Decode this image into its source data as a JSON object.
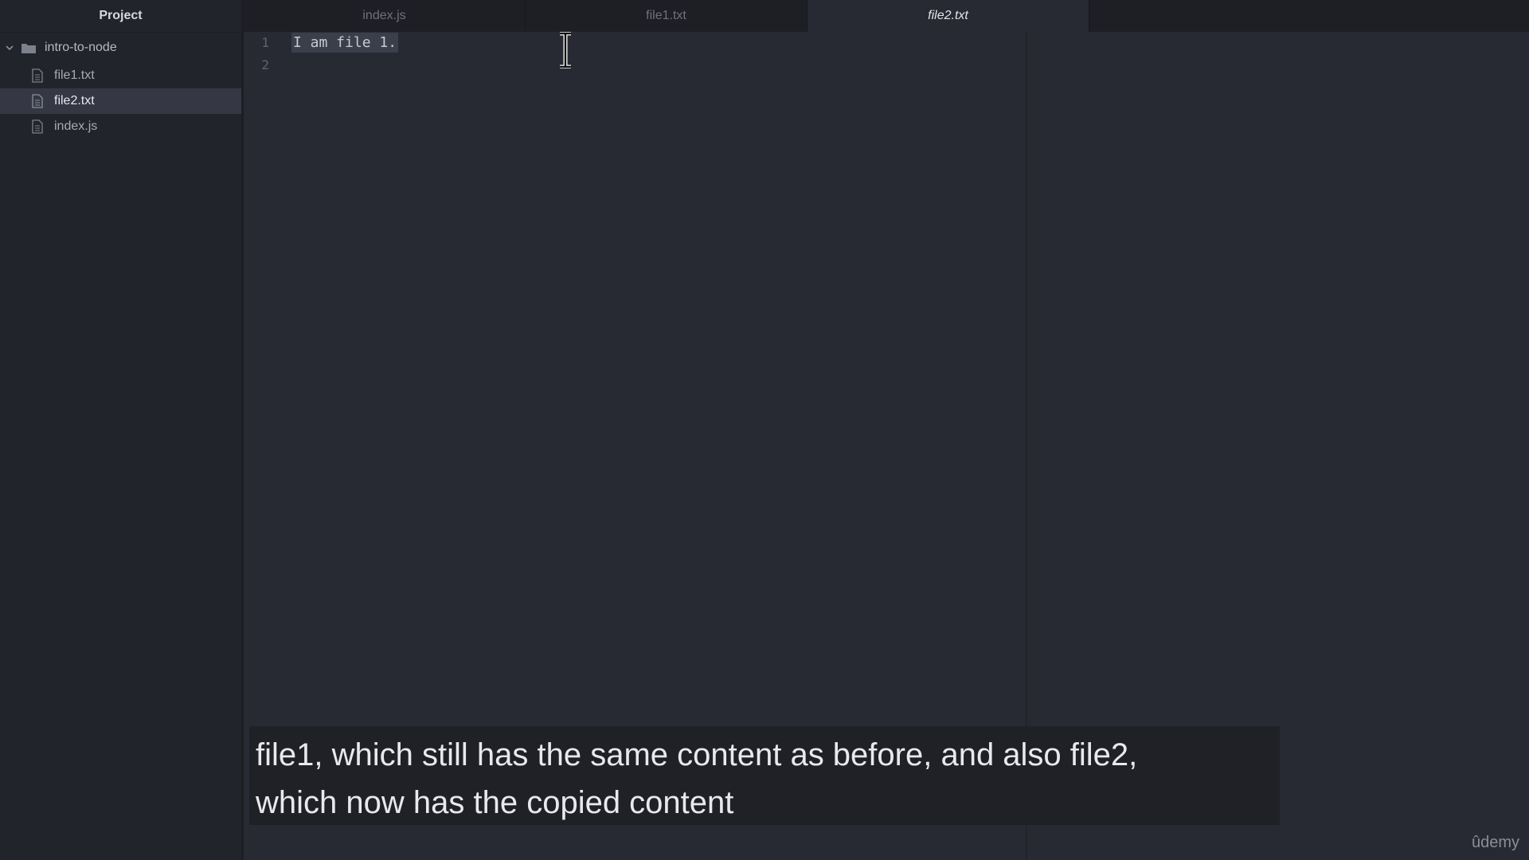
{
  "sidebar": {
    "title": "Project",
    "root_folder": "intro-to-node",
    "files": [
      {
        "name": "file1.txt",
        "selected": false
      },
      {
        "name": "file2.txt",
        "selected": true
      },
      {
        "name": "index.js",
        "selected": false
      }
    ]
  },
  "tabs": [
    {
      "label": "index.js",
      "active": false
    },
    {
      "label": "file1.txt",
      "active": false
    },
    {
      "label": "file2.txt",
      "active": true
    }
  ],
  "editor": {
    "lines": [
      {
        "number": "1",
        "text": "I am file 1."
      },
      {
        "number": "2",
        "text": ""
      }
    ]
  },
  "caption": {
    "line1": "file1, which still has the same content as before, and also file2,",
    "line2": "which now has the copied content"
  },
  "watermark": "ûdemy",
  "colors": {
    "background": "#282a33",
    "sidebar": "#22242b",
    "selected_item": "#353844",
    "caption_bg": "#1f2126"
  }
}
